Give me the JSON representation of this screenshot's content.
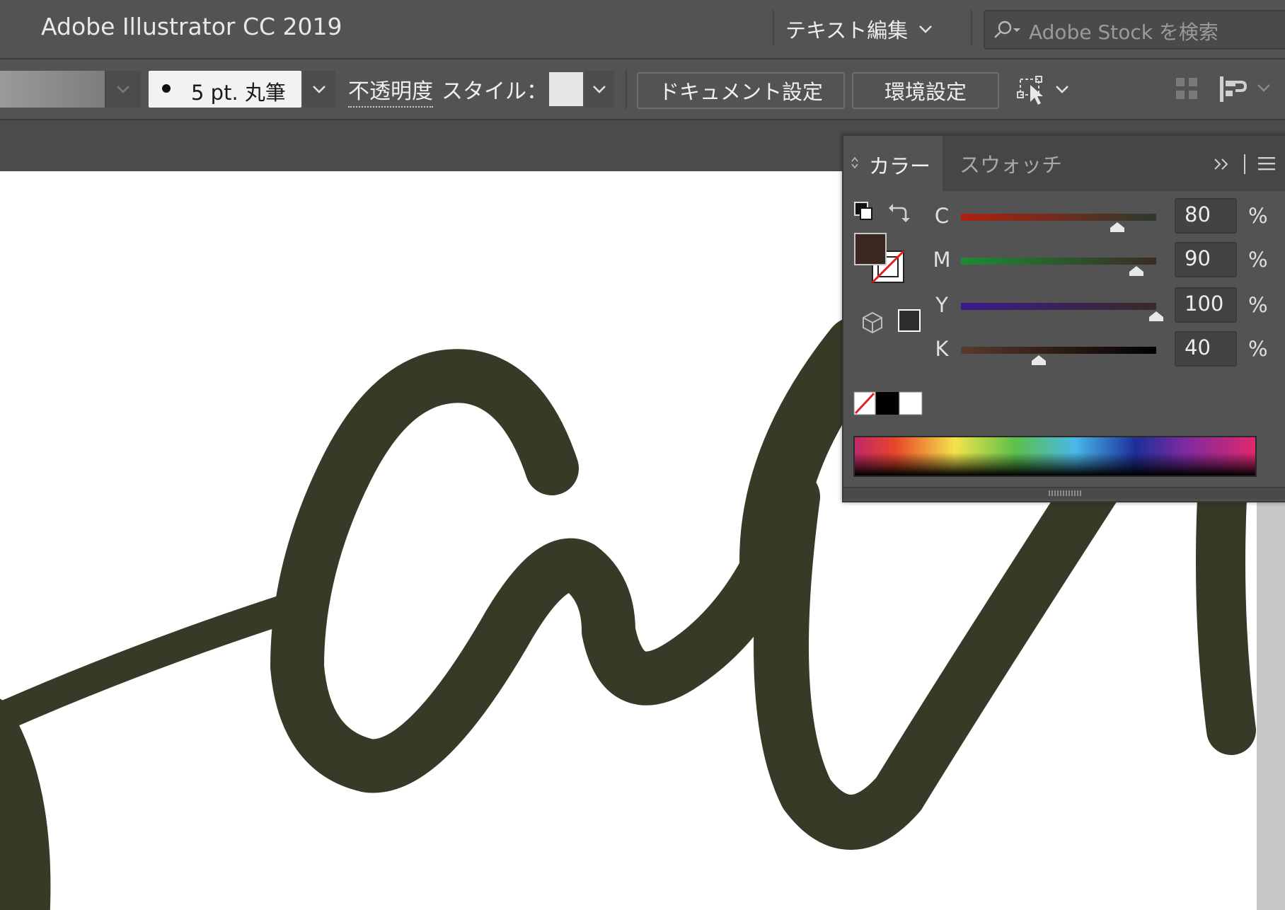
{
  "app": {
    "title": "Adobe Illustrator CC 2019"
  },
  "workspace": {
    "label": "テキスト編集"
  },
  "stock_search": {
    "placeholder": "Adobe Stock を検索"
  },
  "control_bar": {
    "brush_label": "5 pt. 丸筆",
    "opacity_label": "不透明度",
    "style_label": "スタイル：",
    "document_setup_label": "ドキュメント設定",
    "preferences_label": "環境設定"
  },
  "color_panel": {
    "tabs": [
      {
        "label": "カラー",
        "active": true
      },
      {
        "label": "スウォッチ",
        "active": false
      }
    ],
    "sliders": [
      {
        "letter": "C",
        "value": "80",
        "unit": "%",
        "level": 0.8,
        "track_start": "#b02010",
        "track_end": "#2c3a2c"
      },
      {
        "letter": "M",
        "value": "90",
        "unit": "%",
        "level": 0.9,
        "track_start": "#1f8a35",
        "track_end": "#3a2a26"
      },
      {
        "letter": "Y",
        "value": "100",
        "unit": "%",
        "level": 1.0,
        "track_start": "#3a1a8a",
        "track_end": "#3a2a26"
      },
      {
        "letter": "K",
        "value": "40",
        "unit": "%",
        "level": 0.4,
        "track_start": "#5a3a2e",
        "track_end": "#000000"
      }
    ],
    "fill_color": "#3a2820"
  },
  "artwork": {
    "stroke_color": "#373a26"
  }
}
